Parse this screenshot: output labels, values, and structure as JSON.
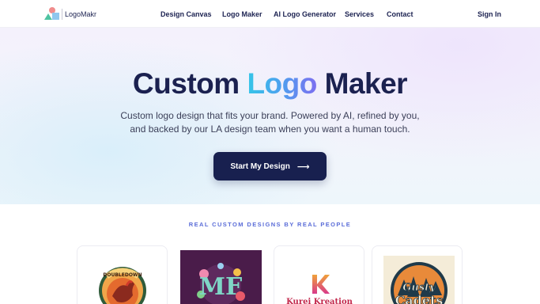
{
  "brand": {
    "name": "LogoMakr"
  },
  "nav": {
    "items": [
      {
        "label": "Design Canvas"
      },
      {
        "label": "Logo Maker"
      },
      {
        "label": "AI Logo Generator"
      },
      {
        "label": "Services"
      },
      {
        "label": "Contact"
      }
    ],
    "signin": "Sign In"
  },
  "hero": {
    "title_part1": "Custom",
    "title_accent": "Logo",
    "title_part2": "Maker",
    "subtitle_line1": "Custom logo design that fits your brand. Powered by AI, refined by you,",
    "subtitle_line2": "and backed by our LA design team when you want a human touch.",
    "cta_label": "Start My Design",
    "cta_icon": "arrow-right-icon"
  },
  "showcase": {
    "label": "REAL CUSTOM DESIGNS BY REAL PEOPLE",
    "cards": [
      {
        "caption": "DOUBLEDOWN"
      },
      {
        "caption": "MF"
      },
      {
        "caption": "Kurei Kreation"
      },
      {
        "caption_line1": "Gusty",
        "caption_line2": "Cadets"
      }
    ]
  },
  "colors": {
    "navy": "#18204f",
    "accent_start": "#35c6e8",
    "accent_end": "#7d6ef0",
    "label_blue": "#5b6dd8"
  }
}
